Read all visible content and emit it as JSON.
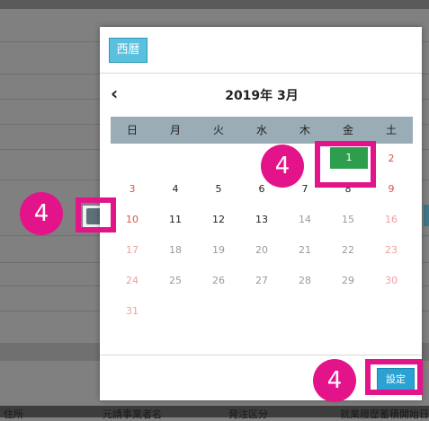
{
  "background": {
    "columns": [
      "住所",
      "元請事業者名",
      "発注区分",
      "就業履歴蓄積開始日"
    ]
  },
  "modal": {
    "era_button": "西暦",
    "prev_icon": "chevron-left",
    "month_title": "2019年 3月",
    "weekdays": [
      "日",
      "月",
      "火",
      "水",
      "木",
      "金",
      "土"
    ],
    "weeks": [
      [
        "",
        "",
        "",
        "",
        "",
        "1",
        "2"
      ],
      [
        "3",
        "4",
        "5",
        "6",
        "7",
        "8",
        "9"
      ],
      [
        "10",
        "11",
        "12",
        "13",
        "14",
        "15",
        "16"
      ],
      [
        "17",
        "18",
        "19",
        "20",
        "21",
        "22",
        "23"
      ],
      [
        "24",
        "25",
        "26",
        "27",
        "28",
        "29",
        "30"
      ],
      [
        "31",
        "",
        "",
        "",
        "",
        "",
        ""
      ]
    ],
    "selected_day": "1",
    "set_button": "設定"
  },
  "annotations": {
    "calendar_marker": "4",
    "date_marker": "4",
    "set_marker": "4"
  },
  "colors": {
    "accent": "#e3138a",
    "selected": "#2e9e4e",
    "button": "#2aa3d4",
    "weekend": "#d9534f"
  }
}
